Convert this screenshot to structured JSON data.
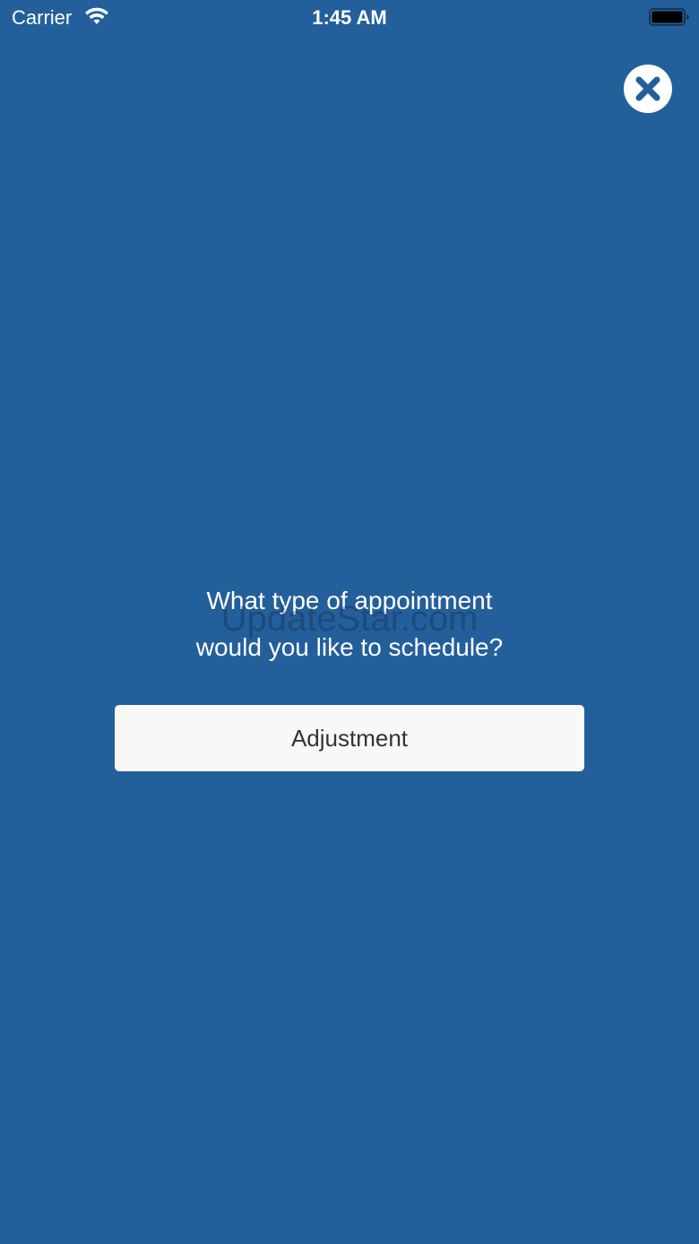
{
  "status_bar": {
    "carrier": "Carrier",
    "time": "1:45 AM",
    "icons": [
      "wifi-icon",
      "battery-icon"
    ]
  },
  "close_icon": "close-icon",
  "prompt": {
    "line1": "What type of appointment",
    "line2": "would you like to schedule?"
  },
  "watermark": "UpdateStar.com",
  "appointment_options": [
    "Adjustment"
  ],
  "colors": {
    "background": "#235f9b",
    "button_background": "#f8f8f7",
    "button_text": "#333333",
    "text": "#ffffff"
  }
}
